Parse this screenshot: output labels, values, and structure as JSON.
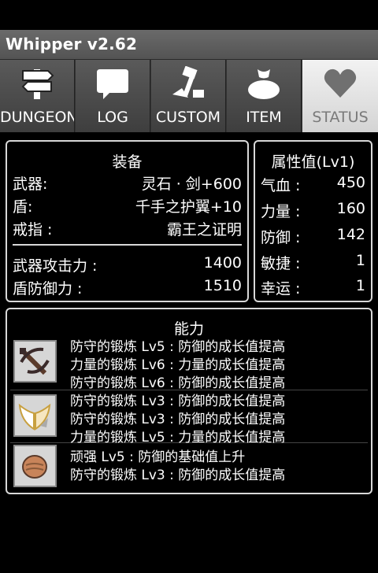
{
  "app": {
    "title": "Whipper   v2.62"
  },
  "tabs": [
    {
      "label": "DUNGEON",
      "icon": "signpost-icon",
      "active": false
    },
    {
      "label": "LOG",
      "icon": "speech-bubble-icon",
      "active": false
    },
    {
      "label": "CUSTOM",
      "icon": "hammer-icon",
      "active": false
    },
    {
      "label": "ITEM",
      "icon": "bag-icon",
      "active": false
    },
    {
      "label": "STATUS",
      "icon": "heart-icon",
      "active": true
    }
  ],
  "equipment": {
    "title": "装备",
    "weapon_label": "武器:",
    "weapon_value": "灵石 · 剑+600",
    "shield_label": "盾:",
    "shield_value": "千手之护翼+10",
    "ring_label": "戒指 :",
    "ring_value": "霸王之证明",
    "attack_label": "武器攻击力 :",
    "attack_value": "1400",
    "defense_label": "盾防御力 :",
    "defense_value": "1510"
  },
  "attributes": {
    "title": "属性值(Lv1)",
    "items": [
      {
        "label": "气血 :",
        "value": "450"
      },
      {
        "label": "力量 :",
        "value": "160"
      },
      {
        "label": "防御 :",
        "value": "142"
      },
      {
        "label": "敏捷 :",
        "value": "1"
      },
      {
        "label": "幸运 :",
        "value": "1"
      }
    ]
  },
  "abilities": {
    "title": "能力",
    "groups": [
      {
        "icon": "crossbow-icon",
        "lines": [
          "防守的锻炼 Lv5 : 防御的成长值提高",
          "力量的锻炼 Lv6 : 力量的成长值提高",
          "防守的锻炼 Lv6 : 防御的成长值提高"
        ]
      },
      {
        "icon": "wings-icon",
        "lines": [
          "防守的锻炼 Lv3 : 防御的成长值提高",
          "防守的锻炼 Lv3 : 防御的成长值提高",
          "力量的锻炼 Lv5 : 力量的成长值提高"
        ]
      },
      {
        "icon": "stone-icon",
        "lines": [
          "顽强 Lv5 : 防御的基础值上升",
          "防守的锻炼 Lv3 : 防御的成长值提高"
        ]
      }
    ]
  }
}
